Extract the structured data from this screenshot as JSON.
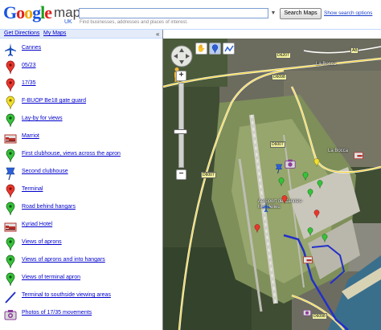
{
  "header": {
    "logo_google": "Google",
    "logo_maps": "maps",
    "logo_region": "UK",
    "search_value": "",
    "search_hint": "Find businesses, addresses and places of interest.",
    "search_button": "Search Maps",
    "search_options": "Show search options"
  },
  "nav": {
    "get_directions": "Get Directions",
    "my_maps": "My Maps",
    "collapse_glyph": "«"
  },
  "sidebar": {
    "items": [
      {
        "label": "Cannes",
        "icon": "airplane-icon"
      },
      {
        "label": "05/23",
        "icon": "red-pin-icon"
      },
      {
        "label": "17/35",
        "icon": "red-pin-icon"
      },
      {
        "label": "F-BUOP Be18 gate guard",
        "icon": "yellow-pin-icon"
      },
      {
        "label": "Lay-by for views",
        "icon": "green-pin-icon"
      },
      {
        "label": "Marriot",
        "icon": "bed-icon"
      },
      {
        "label": "First clubhouse, views across the apron",
        "icon": "green-pin-icon"
      },
      {
        "label": "Second clubhouse",
        "icon": "blue-pushpin-icon"
      },
      {
        "label": "Terminal",
        "icon": "red-pin-icon"
      },
      {
        "label": "Road behind hangars",
        "icon": "green-pin-icon"
      },
      {
        "label": "Kyriad Hotel",
        "icon": "bed-icon"
      },
      {
        "label": "Views of aprons",
        "icon": "green-pin-icon"
      },
      {
        "label": "Views of aprons and into hangars",
        "icon": "green-pin-icon"
      },
      {
        "label": "Views of terminal apron",
        "icon": "green-pin-icon"
      },
      {
        "label": "Terminal to southside viewing areas",
        "icon": "blue-line-icon"
      },
      {
        "label": "Photos of 17/35 movements",
        "icon": "camera-icon"
      }
    ]
  },
  "map": {
    "road_labels": [
      "A8",
      "D6207",
      "D6098",
      "D6007",
      "D6007",
      "D6098"
    ],
    "place_labels": [
      "La Bocca",
      "La Bocca",
      "Aéroport de Cannes-Mandelieu"
    ],
    "controls": {
      "zoom_in": "+",
      "zoom_out": "−",
      "hand": "✋",
      "pin": "📍",
      "line": "〰"
    }
  }
}
